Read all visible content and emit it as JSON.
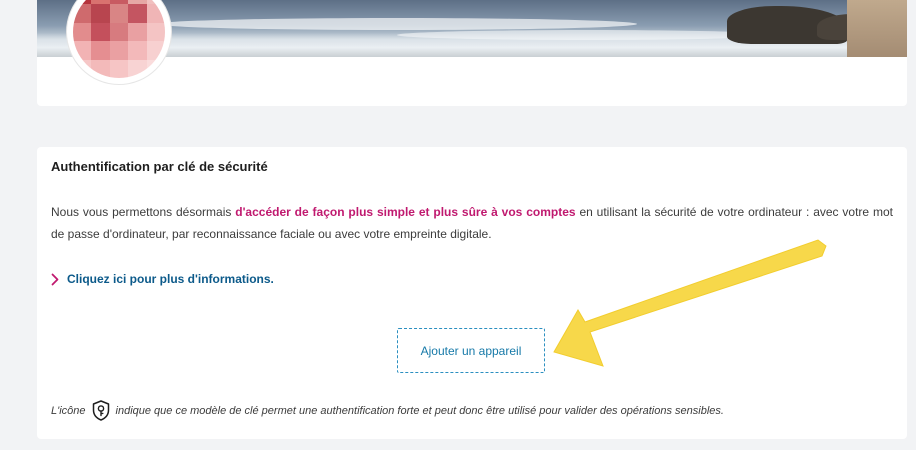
{
  "profile": {
    "avatar_colors": [
      "#b5333c",
      "#d9726f",
      "#c85b62",
      "#e6a7a5",
      "#f1c0bf",
      "#cf6a6d",
      "#b8454f",
      "#d98585",
      "#c45561",
      "#f0b5b6",
      "#e28c8d",
      "#c4505c",
      "#d77b7f",
      "#e9a0a2",
      "#f4c4c4",
      "#f2b3b4",
      "#e58e91",
      "#eaa0a2",
      "#f3b9ba",
      "#f7d0d0",
      "#f6c7c7",
      "#f3baba",
      "#f6c5c5",
      "#f8d3d3",
      "#fadcdc"
    ]
  },
  "security": {
    "title": "Authentification par clé de sécurité",
    "intro_before": "Nous vous permettons désormais ",
    "intro_highlight": "d'accéder de façon plus simple et plus sûre à vos comptes",
    "intro_after": " en utilisant la sécurité de votre ordinateur : avec votre mot de passe d'ordinateur, par reconnaissance faciale ou avec votre empreinte digitale.",
    "link_label": "Cliquez ici pour plus d'informations.",
    "add_device_label": "Ajouter un appareil",
    "note_before": "L'icône",
    "note_after": "indique que ce modèle de clé permet une authentification forte et peut donc être utilisé pour valider des opérations sensibles.",
    "highlight_color": "#c0196f",
    "link_color": "#0c5a8a"
  },
  "annotation": {
    "arrow_color": "#f7d84a"
  }
}
